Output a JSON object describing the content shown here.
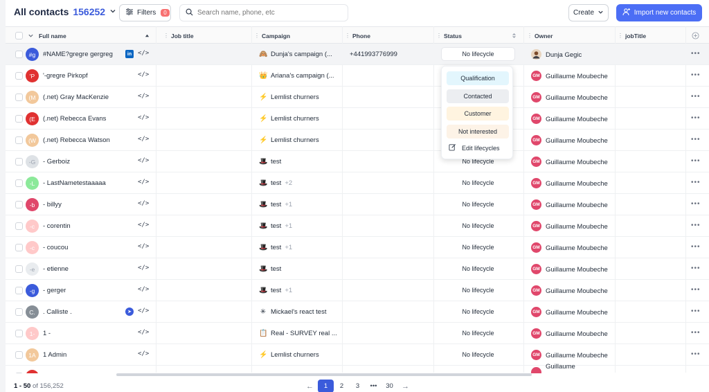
{
  "header": {
    "title": "All contacts",
    "count": "156252",
    "filters_label": "Filters",
    "filters_count": "0",
    "search_placeholder": "Search name, phone, etc",
    "create_label": "Create",
    "import_label": "Import new contacts"
  },
  "columns": {
    "full_name": "Full name",
    "job_title": "Job title",
    "campaign": "Campaign",
    "phone": "Phone",
    "status": "Status",
    "owner": "Owner",
    "job_title_2": "jobTitle"
  },
  "rows": [
    {
      "initials": "#g",
      "avatar_color": "#3b5bdb",
      "name": "#NAME?gregre gergreg",
      "badge": "linkedin",
      "campaign_icon": "🙈",
      "campaign": "Dunja's campaign (...",
      "campaign_extra": "",
      "phone": "+441993776999",
      "status": "No lifecycle",
      "owner": "Dunja Gegic",
      "owner_initials": "DG",
      "owner_color": "#a16207"
    },
    {
      "initials": "'P",
      "avatar_color": "#e03131",
      "name": "'-gregre Pirkopf",
      "badge": "",
      "campaign_icon": "👑",
      "campaign": "Ariana's campaign (...",
      "campaign_extra": "",
      "phone": "",
      "status": "",
      "owner": "Guillaume Moubeche",
      "owner_initials": "GM",
      "owner_color": "#e0476b"
    },
    {
      "initials": "(M",
      "avatar_color": "#f2c89b",
      "name": "(.net) Gray MacKenzie",
      "badge": "",
      "campaign_icon": "⚡",
      "campaign": "Lemlist churners",
      "campaign_extra": "",
      "phone": "",
      "status": "",
      "owner": "Guillaume Moubeche",
      "owner_initials": "GM",
      "owner_color": "#e0476b"
    },
    {
      "initials": "(E",
      "avatar_color": "#e03131",
      "name": "(.net) Rebecca Evans",
      "badge": "",
      "campaign_icon": "⚡",
      "campaign": "Lemlist churners",
      "campaign_extra": "",
      "phone": "",
      "status": "",
      "owner": "Guillaume Moubeche",
      "owner_initials": "GM",
      "owner_color": "#e0476b"
    },
    {
      "initials": "(W",
      "avatar_color": "#f2c89b",
      "name": "(.net) Rebecca Watson",
      "badge": "",
      "campaign_icon": "⚡",
      "campaign": "Lemlist churners",
      "campaign_extra": "",
      "phone": "",
      "status": "",
      "owner": "Guillaume Moubeche",
      "owner_initials": "GM",
      "owner_color": "#e0476b"
    },
    {
      "initials": "-G",
      "avatar_color": "#dee2e6",
      "name": "- Gerboiz",
      "badge": "",
      "campaign_icon": "🎩",
      "campaign": "test",
      "campaign_extra": "",
      "phone": "",
      "status": "No lifecycle",
      "owner": "Guillaume Moubeche",
      "owner_initials": "GM",
      "owner_color": "#e0476b"
    },
    {
      "initials": "-L",
      "avatar_color": "#8ce99a",
      "name": "- LastNametestaaaaa",
      "badge": "",
      "campaign_icon": "🎩",
      "campaign": "test",
      "campaign_extra": "+2",
      "phone": "",
      "status": "No lifecycle",
      "owner": "Guillaume Moubeche",
      "owner_initials": "GM",
      "owner_color": "#e0476b"
    },
    {
      "initials": "-b",
      "avatar_color": "#e0476b",
      "name": "- billyy",
      "badge": "",
      "campaign_icon": "🎩",
      "campaign": "test",
      "campaign_extra": "+1",
      "phone": "",
      "status": "No lifecycle",
      "owner": "Guillaume Moubeche",
      "owner_initials": "GM",
      "owner_color": "#e0476b"
    },
    {
      "initials": "-c",
      "avatar_color": "#ffc9c9",
      "name": "- corentin",
      "badge": "",
      "campaign_icon": "🎩",
      "campaign": "test",
      "campaign_extra": "+1",
      "phone": "",
      "status": "No lifecycle",
      "owner": "Guillaume Moubeche",
      "owner_initials": "GM",
      "owner_color": "#e0476b"
    },
    {
      "initials": "-c",
      "avatar_color": "#ffc9c9",
      "name": "- coucou",
      "badge": "",
      "campaign_icon": "🎩",
      "campaign": "test",
      "campaign_extra": "+1",
      "phone": "",
      "status": "No lifecycle",
      "owner": "Guillaume Moubeche",
      "owner_initials": "GM",
      "owner_color": "#e0476b"
    },
    {
      "initials": "-e",
      "avatar_color": "#e9ecef",
      "name": "- etienne",
      "badge": "",
      "campaign_icon": "🎩",
      "campaign": "test",
      "campaign_extra": "",
      "phone": "",
      "status": "No lifecycle",
      "owner": "Guillaume Moubeche",
      "owner_initials": "GM",
      "owner_color": "#e0476b"
    },
    {
      "initials": "-g",
      "avatar_color": "#3b5bdb",
      "name": "- gerger",
      "badge": "",
      "campaign_icon": "🎩",
      "campaign": "test",
      "campaign_extra": "+1",
      "phone": "",
      "status": "No lifecycle",
      "owner": "Guillaume Moubeche",
      "owner_initials": "GM",
      "owner_color": "#e0476b"
    },
    {
      "initials": "C.",
      "avatar_color": "#868e96",
      "name": ". Calliste .",
      "badge": "compass",
      "campaign_icon": "✳",
      "campaign": "Mickael's react test",
      "campaign_extra": "",
      "phone": "",
      "status": "No lifecycle",
      "owner": "Guillaume Moubeche",
      "owner_initials": "GM",
      "owner_color": "#e0476b"
    },
    {
      "initials": "1-",
      "avatar_color": "#ffc9c9",
      "name": "1 -",
      "badge": "",
      "campaign_icon": "📋",
      "campaign": "Real - SURVEY real ...",
      "campaign_extra": "",
      "phone": "",
      "status": "No lifecycle",
      "owner": "Guillaume Moubeche",
      "owner_initials": "GM",
      "owner_color": "#e0476b"
    },
    {
      "initials": "1A",
      "avatar_color": "#f2c89b",
      "name": "1 Admin",
      "badge": "",
      "campaign_icon": "⚡",
      "campaign": "Lemlist churners",
      "campaign_extra": "",
      "phone": "",
      "status": "No lifecycle",
      "owner": "Guillaume Moubeche",
      "owner_initials": "GM",
      "owner_color": "#e0476b"
    },
    {
      "initials": "",
      "avatar_color": "#e03131",
      "name": "",
      "badge": "",
      "campaign_icon": "",
      "campaign": "",
      "campaign_extra": "",
      "phone": "",
      "status": "",
      "owner": "Guillaume",
      "owner_initials": "",
      "owner_color": "#e0476b"
    }
  ],
  "dropdown": {
    "options": [
      {
        "label": "Qualification",
        "color": "#e3f6fd"
      },
      {
        "label": "Contacted",
        "color": "#eceef1"
      },
      {
        "label": "Customer",
        "color": "#fff4e0"
      },
      {
        "label": "Not interested",
        "color": "#fdf3e7"
      }
    ],
    "edit_label": "Edit lifecycles"
  },
  "footer": {
    "range_start": "1 - 50",
    "range_of": "of 156,252",
    "pages": [
      "1",
      "2",
      "3",
      "•••",
      "30"
    ],
    "active_page": "1",
    "prev": "←",
    "next": "→"
  }
}
